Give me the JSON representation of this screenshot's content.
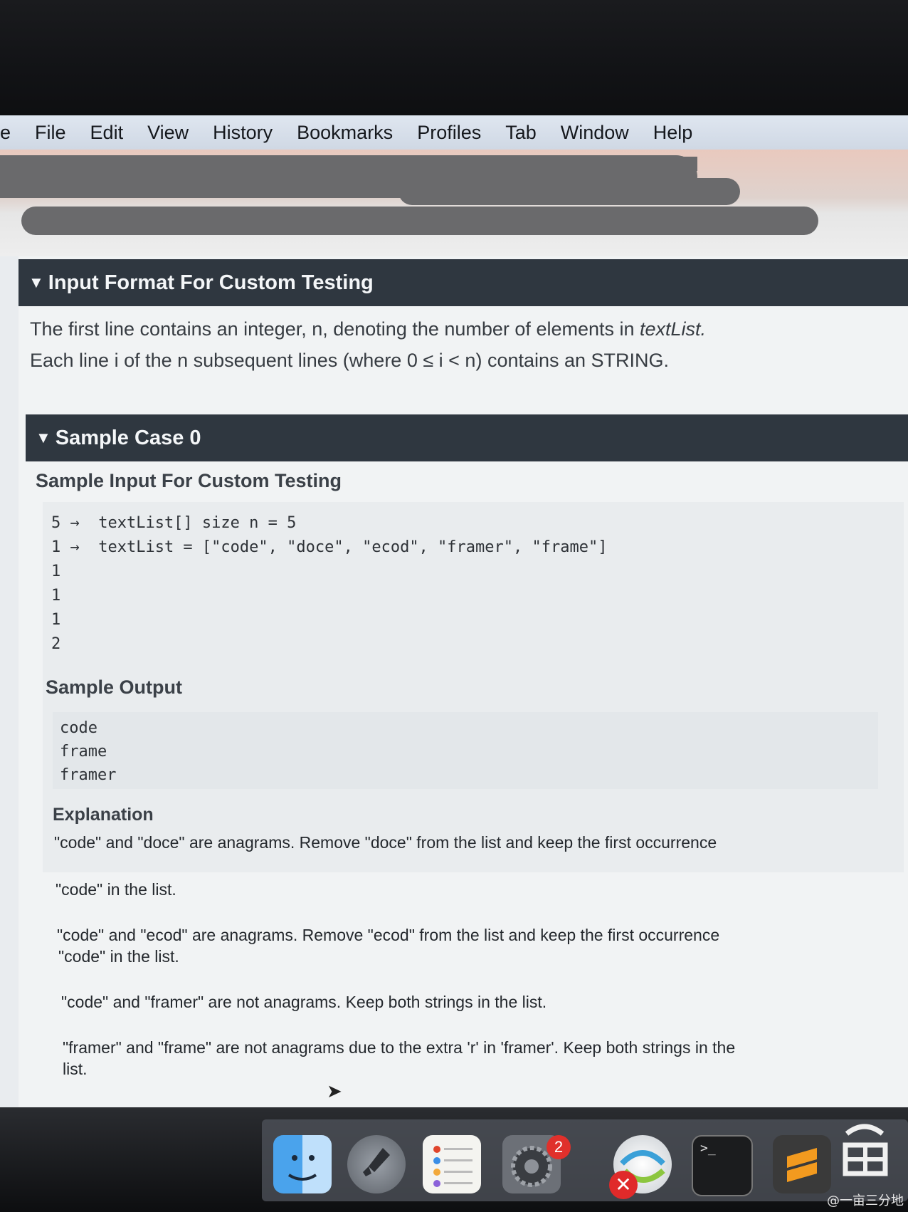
{
  "menubar": {
    "app_fragment": "e",
    "items": [
      "File",
      "Edit",
      "View",
      "History",
      "Bookmarks",
      "Profiles",
      "Tab",
      "Window",
      "Help"
    ]
  },
  "input_format": {
    "title": "Input Format For Custom Testing",
    "line1_prefix": "The first line contains an integer, n, denoting the number of elements in ",
    "line1_italic": "textList.",
    "line2": "Each line i of the n subsequent lines (where 0 ≤ i < n) contains an STRING."
  },
  "sample_case": {
    "title": "Sample Case 0",
    "input_heading": "Sample Input For Custom Testing",
    "input_lines": [
      "5 →  textList[] size n = 5",
      "1 →  textList = [\"code\", \"doce\", \"ecod\", \"framer\", \"frame\"]",
      "1",
      "1",
      "1",
      "2"
    ],
    "output_heading": "Sample Output",
    "output_lines": [
      "code",
      "frame",
      "framer"
    ],
    "explanation_heading": "Explanation",
    "explanation": [
      "\"code\" and \"doce\" are anagrams. Remove \"doce\" from the list and keep the first occurrence",
      "\"code\" in the list.",
      "\"code\" and \"ecod\" are anagrams. Remove \"ecod\" from the list and keep the first occurrence",
      "\"code\" in the list.",
      "\"code\" and \"framer\" are not anagrams. Keep both strings in the list.",
      "\"framer\" and \"frame\" are not anagrams due to the extra 'r' in 'framer'. Keep both strings in the",
      "list."
    ]
  },
  "dock": {
    "icons": [
      "finder-icon",
      "launchpad-icon",
      "reminders-icon",
      "system-preferences-icon",
      "network-icon",
      "terminal-icon",
      "sublime-text-icon"
    ],
    "system_preferences_badge": "2",
    "terminal_glyph": ">_"
  },
  "watermark": "@一亩三分地"
}
